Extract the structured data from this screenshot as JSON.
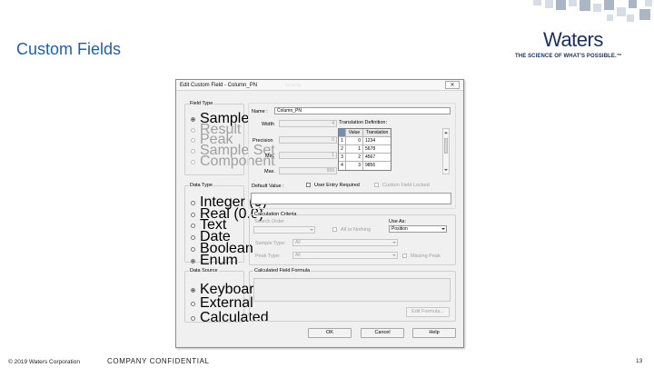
{
  "slide": {
    "title": "Custom Fields",
    "logo_word": "Waters",
    "logo_tagline": "THE SCIENCE OF WHAT'S POSSIBLE.™",
    "copyright": "© 2019 Waters Corporation",
    "confidential": "COMPANY CONFIDENTIAL",
    "page_number": "13"
  },
  "dialog": {
    "title": "Edit Custom Field - Column_PN",
    "close_glyph": "✕",
    "field_type": {
      "legend": "Field Type",
      "options": [
        "Sample",
        "Result",
        "Peak",
        "Sample Set",
        "Component"
      ],
      "selected": "Sample"
    },
    "data_type": {
      "legend": "Data Type",
      "options": [
        "Integer (0)",
        "Real (0.0)",
        "Text",
        "Date",
        "Boolean",
        "Enum"
      ],
      "selected": "Enum"
    },
    "data_source": {
      "legend": "Data Source",
      "options": [
        "Keyboard",
        "External",
        "Calculated"
      ],
      "selected": "Keyboard"
    },
    "properties": {
      "name_label": "Name :",
      "name_value": "Column_PN",
      "width_label": "Width",
      "width_value": "4",
      "precision_label": "Precision",
      "precision_value": "0",
      "min_label": "Min.",
      "min_value": "1",
      "max_label": "Max.",
      "max_value": "999",
      "translation_label": "Translation Definition:",
      "default_label": "Default Value :",
      "user_entry_label": "User Entry Required",
      "custom_locked_label": "Custom Field Locked"
    },
    "translation_table": {
      "headers": [
        "",
        "Value",
        "Translation"
      ],
      "rows": [
        [
          "1",
          "0",
          "1234"
        ],
        [
          "2",
          "1",
          "5678"
        ],
        [
          "3",
          "2",
          "4567"
        ],
        [
          "4",
          "3",
          "9856"
        ]
      ]
    },
    "calculation": {
      "legend": "Calculation Criteria",
      "search_order_label": "Search Order",
      "all_or_nothing_label": "All or Nothing",
      "use_as_label": "Use As:",
      "use_as_value": "Position",
      "sample_type_label": "Sample Type:",
      "sample_type_value": "All",
      "peak_type_label": "Peak Type:",
      "peak_type_value": "All",
      "missing_peak_label": "Missing Peak"
    },
    "formula": {
      "legend": "Calculated Field Formula",
      "edit_button": "Edit Formula..."
    },
    "buttons": {
      "ok": "OK",
      "cancel": "Cancel",
      "help": "Help"
    }
  }
}
